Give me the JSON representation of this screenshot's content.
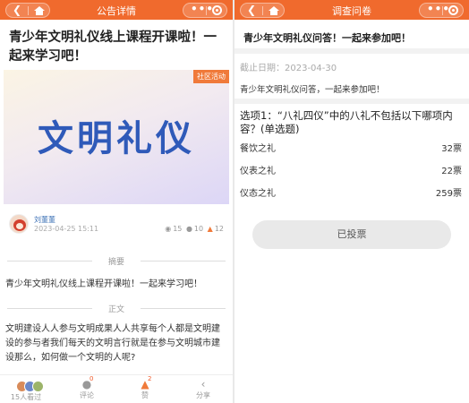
{
  "left": {
    "nav_title": "公告详情",
    "article_title": "青少年文明礼仪线上课程开课啦！一起来学习吧！",
    "banner_tag": "社区活动",
    "banner_text": "文明礼仪",
    "author": "刘董董",
    "date": "2023-04-25 15:11",
    "views": "15",
    "comments": "10",
    "likes": "12",
    "summary_label": "摘要",
    "summary_text": "青少年文明礼仪线上课程开课啦！一起来学习吧！",
    "body_label": "正文",
    "body_text": "文明建设人人参与文明成果人人共享每个人都是文明建设的参与者我们每天的文明言行就是在参与文明城市建设那么，如何做一个文明的人呢?",
    "bottom": {
      "seen_label": "15人看过",
      "comment_label": "评论",
      "comment_badge": "0",
      "like_label": "赞",
      "like_badge": "2",
      "share_label": "分享"
    }
  },
  "right": {
    "nav_title": "调查问卷",
    "survey_title": "青少年文明礼仪问答！一起来参加吧！",
    "deadline": "截止日期：2023-04-30",
    "description": "青少年文明礼仪问答，一起来参加吧！",
    "question": "选项1：“八礼四仪”中的八礼不包括以下哪项内容？(单选题)",
    "options": [
      {
        "label": "餐饮之礼",
        "votes": "32票"
      },
      {
        "label": "仪表之礼",
        "votes": "22票"
      },
      {
        "label": "仪态之礼",
        "votes": "259票"
      }
    ],
    "vote_button": "已投票"
  },
  "colors": {
    "accent": "#f06a2d",
    "banner_text": "#2f5ab9",
    "author": "#3a6fb5"
  }
}
